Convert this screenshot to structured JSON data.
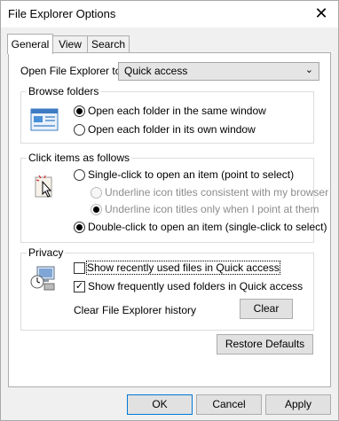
{
  "window": {
    "title": "File Explorer Options"
  },
  "tabs": [
    {
      "label": "General",
      "active": true
    },
    {
      "label": "View",
      "active": false
    },
    {
      "label": "Search",
      "active": false
    }
  ],
  "general": {
    "open_label": "Open File Explorer to:",
    "open_value": "Quick access",
    "browse": {
      "title": "Browse folders",
      "option1": "Open each folder in the same window",
      "option2": "Open each folder in its own window",
      "selected": "option1"
    },
    "click": {
      "title": "Click items as follows",
      "option_single": "Single-click to open an item (point to select)",
      "sub1": "Underline icon titles consistent with my browser",
      "sub2": "Underline icon titles only when I point at them",
      "option_double": "Double-click to open an item (single-click to select)",
      "selected": "option_double"
    },
    "privacy": {
      "title": "Privacy",
      "check1": "Show recently used files in Quick access",
      "check1_checked": false,
      "check2": "Show frequently used folders in Quick access",
      "check2_checked": true,
      "history_label": "Clear File Explorer history",
      "clear_button": "Clear"
    },
    "restore_button": "Restore Defaults"
  },
  "buttons": {
    "ok": "OK",
    "cancel": "Cancel",
    "apply": "Apply"
  },
  "icons": {
    "close": "close-icon",
    "chevron": "chevron-down-icon",
    "browse": "folder-window-icon",
    "click": "cursor-click-icon",
    "privacy": "privacy-computer-icon"
  }
}
